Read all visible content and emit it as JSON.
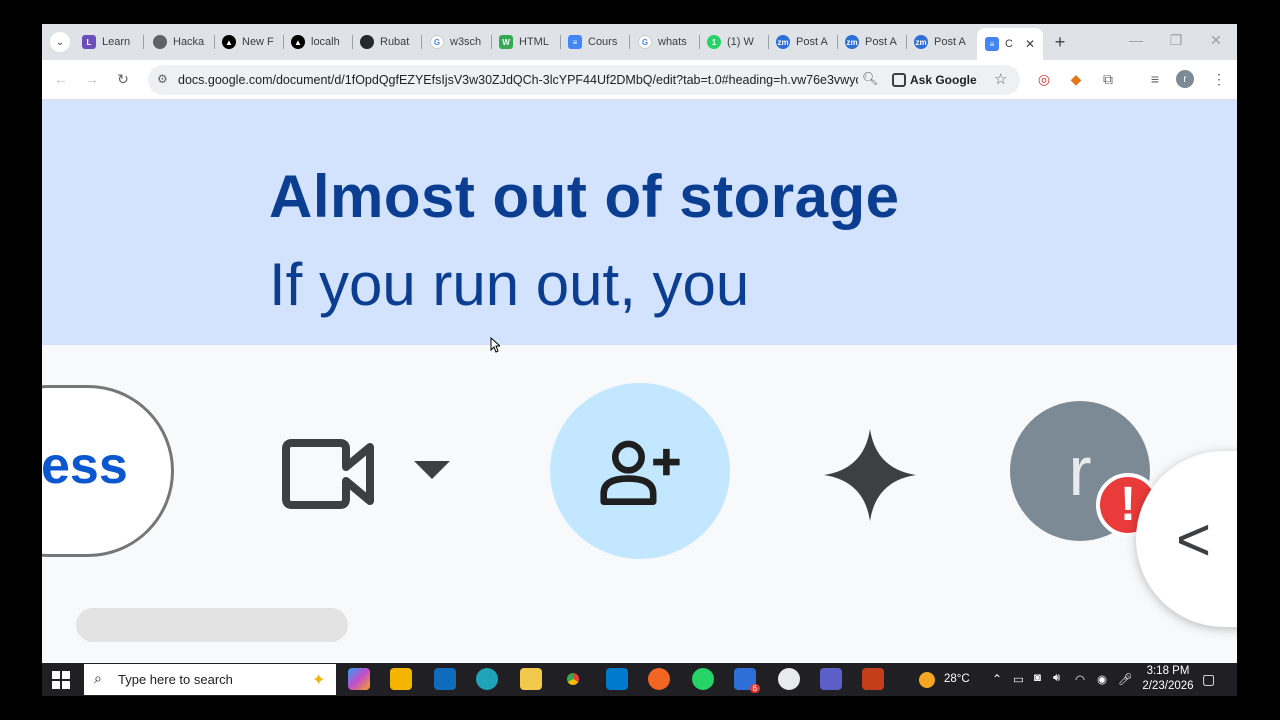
{
  "browser": {
    "tabs": [
      {
        "label": "Learn",
        "icon": "lms-icon",
        "color": "#6b4fbb"
      },
      {
        "label": "Hacka",
        "icon": "globe-icon",
        "color": "#5f6368"
      },
      {
        "label": "New F",
        "icon": "triangle-logo-icon",
        "color": "#000000"
      },
      {
        "label": "localh",
        "icon": "triangle-logo-icon",
        "color": "#000000"
      },
      {
        "label": "Rubat",
        "icon": "github-icon",
        "color": "#24292f"
      },
      {
        "label": "w3sch",
        "icon": "google-icon",
        "color": "#4285f4"
      },
      {
        "label": "HTML",
        "icon": "w-logo-icon",
        "color": "#34a853"
      },
      {
        "label": "Cours",
        "icon": "docs-icon",
        "color": "#4285f4"
      },
      {
        "label": "whats",
        "icon": "google-icon",
        "color": "#4285f4"
      },
      {
        "label": "(1) W",
        "icon": "whatsapp-icon",
        "color": "#25d366"
      },
      {
        "label": "Post A",
        "icon": "zm-icon",
        "color": "#2d6fd6"
      },
      {
        "label": "Post A",
        "icon": "zm-icon",
        "color": "#2d6fd6"
      },
      {
        "label": "Post A",
        "icon": "zm-icon",
        "color": "#2d6fd6"
      }
    ],
    "active_tab": {
      "label": "C",
      "icon": "docs-icon"
    },
    "url": "docs.google.com/document/d/1fOpdQgfEZYEfsIjsV3w30ZJdQCh-3lcYPF44Uf2DMbQ/edit?tab=t.0#heading=h.vw76e3vwyd...",
    "ask_google": "Ask Google",
    "profile_initial": "r"
  },
  "banner": {
    "title": "Almost out of storage",
    "subtitle": "If you run out, you"
  },
  "docs_toolbar": {
    "share_button_text": "ess",
    "avatar_initial": "r",
    "alert_symbol": "!",
    "side_panel_symbol": "<"
  },
  "taskbar": {
    "search_placeholder": "Type here to search",
    "temperature": "28°C",
    "time": "3:18 PM",
    "date": "2/23/2026",
    "zoom_badge": "6"
  }
}
